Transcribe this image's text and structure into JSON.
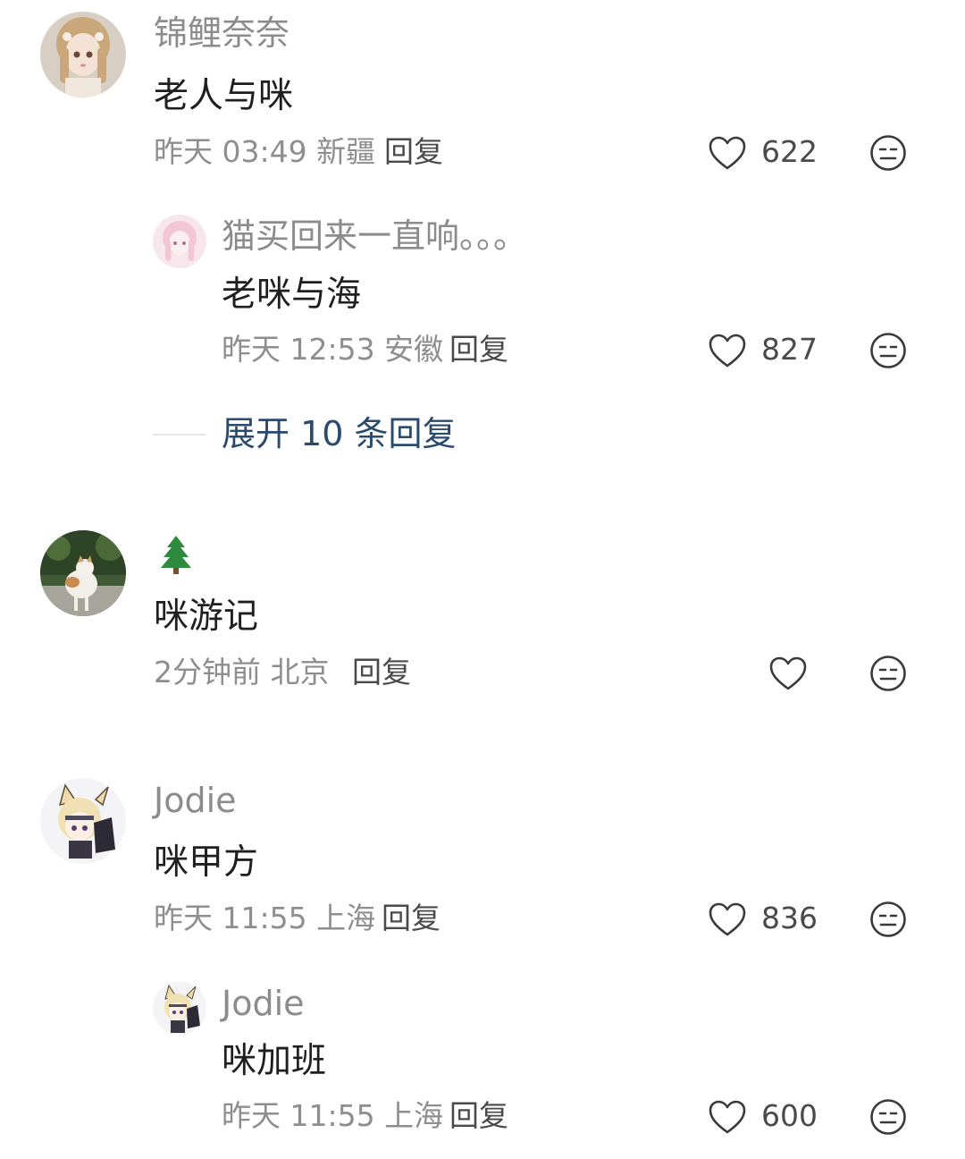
{
  "comments": [
    {
      "username": "锦鲤奈奈",
      "content": "老人与咪",
      "time": "昨天 03:49",
      "location": "新疆",
      "reply_label": "回复",
      "likes": "622",
      "replies": [
        {
          "username": "猫买回来一直响。。。",
          "content": "老咪与海",
          "time": "昨天 12:53",
          "location": "安徽",
          "reply_label": "回复",
          "likes": "827"
        }
      ],
      "expand_label": "展开 10 条回复"
    },
    {
      "username_icon": "evergreen-tree-emoji",
      "content": "咪游记",
      "time": "2分钟前",
      "location": "北京",
      "reply_label": "回复",
      "likes": ""
    },
    {
      "username": "Jodie",
      "content": "咪甲方",
      "time": "昨天 11:55",
      "location": "上海",
      "reply_label": "回复",
      "likes": "836",
      "replies": [
        {
          "username": "Jodie",
          "content": "咪加班",
          "time": "昨天 11:55",
          "location": "上海",
          "reply_label": "回复",
          "likes": "600"
        }
      ]
    }
  ],
  "colors": {
    "username": "#8c8c8c",
    "content": "#1f1f1f",
    "meta": "#8e8e8e",
    "expand_link": "#2a4a6e",
    "icon_stroke": "#3a3a3a"
  }
}
